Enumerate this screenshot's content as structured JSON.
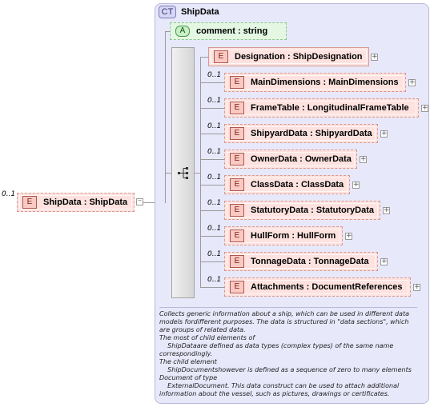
{
  "root": {
    "cardinality": "0..1",
    "badge": "E",
    "label": "ShipData : ShipData"
  },
  "complex_type": {
    "badge": "CT",
    "title": "ShipData"
  },
  "attribute": {
    "badge": "A",
    "label": "comment : string"
  },
  "elements": [
    {
      "badge": "E",
      "label": "Designation : ShipDesignation",
      "cardinality": ""
    },
    {
      "badge": "E",
      "label": "MainDimensions  : MainDimensions",
      "cardinality": "0..1"
    },
    {
      "badge": "E",
      "label": "FrameTable  : LongitudinalFrameTable",
      "cardinality": "0..1"
    },
    {
      "badge": "E",
      "label": "ShipyardData  : ShipyardData",
      "cardinality": "0..1"
    },
    {
      "badge": "E",
      "label": "OwnerData : OwnerData",
      "cardinality": "0..1"
    },
    {
      "badge": "E",
      "label": "ClassData  : ClassData",
      "cardinality": "0..1"
    },
    {
      "badge": "E",
      "label": "StatutoryData  : StatutoryData",
      "cardinality": "0..1"
    },
    {
      "badge": "E",
      "label": "HullForm  : HullForm",
      "cardinality": "0..1"
    },
    {
      "badge": "E",
      "label": "TonnageData  : TonnageData",
      "cardinality": "0..1"
    },
    {
      "badge": "E",
      "label": "Attachments  : DocumentReferences",
      "cardinality": "0..1"
    }
  ],
  "documentation": [
    "Collects generic information about a ship, which can be used in different data",
    "models fordifferent purposes. The data is structured in \"data sections\", which",
    "are groups of related data.",
    "The most of child elements of",
    "    ShipDataare defined as data types (complex types) of the same name",
    "correspondingly.",
    "The child element",
    "    ShipDocumentshowever is defined as a sequence of zero to many elements",
    "Document of type",
    "    ExternalDocument. This data construct can be used to attach additional",
    "information about the vessel, such as pictures, drawings or certificates."
  ]
}
